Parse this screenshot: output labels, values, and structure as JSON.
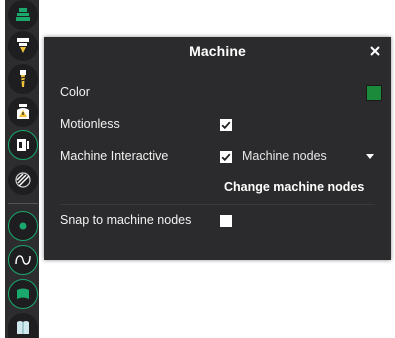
{
  "toolbar": {
    "tools": [
      {
        "name": "layer-stack-icon"
      },
      {
        "name": "nozzle-icon"
      },
      {
        "name": "drill-bit-icon"
      },
      {
        "name": "machine-warning-icon"
      },
      {
        "name": "machine-profile-icon"
      },
      {
        "name": "hatch-pattern-icon"
      },
      {
        "name": "point-node-icon"
      },
      {
        "name": "wave-curve-icon"
      },
      {
        "name": "surface-shape-icon"
      },
      {
        "name": "book-cover-icon"
      }
    ]
  },
  "panel": {
    "title": "Machine",
    "close_icon": "close-icon",
    "color": {
      "label": "Color",
      "value": "#1b8a3b"
    },
    "motionless": {
      "label": "Motionless",
      "checked": true
    },
    "machine_interactive": {
      "label": "Machine Interactive",
      "checked": true,
      "selected": "Machine nodes"
    },
    "change_nodes": {
      "label": "Change machine nodes"
    },
    "snap": {
      "label": "Snap to machine nodes",
      "checked": false
    }
  },
  "colors": {
    "panel_bg": "#2b2b2d",
    "accent": "#1aa86c",
    "swatch": "#1b8a3b"
  }
}
